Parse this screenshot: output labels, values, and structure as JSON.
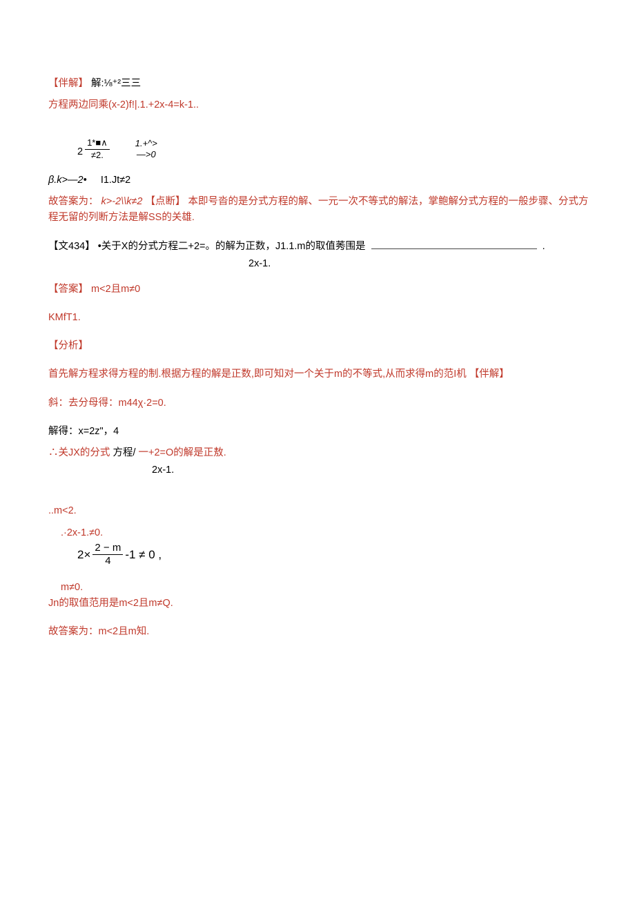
{
  "watermark": "",
  "l1": {
    "tag": "【伴解】",
    "body": "解:⅛⁺²三三"
  },
  "l2": "方程两边同乘(x-2)f!|.1.+2x-4=k-1..",
  "frac2": {
    "lhs_pre": "2",
    "num1": "1*■∧",
    "den1": "≠2.",
    "num2": "1.+^>",
    "den2": "—>0"
  },
  "l3": {
    "a": "β.k>—2•",
    "b": "I1.Jt≠2"
  },
  "l4": {
    "a": "故答案为：",
    "b": "k>-2\\\\k≠2",
    "c": "【点断】",
    "d": "本即号沓的是分式方程的解、一元一次不等式的解法，掌鲍解分式方程的一般步骤、分式方程无留的列断方法是解SS的关雄."
  },
  "q": {
    "label": "【文434】",
    "body": "•关于X的分式方程二+2=。的解为正数，J1.1.m的取值莠围是",
    "tail": ".",
    "sub": "2x-1."
  },
  "ans": {
    "tag": "【答案】",
    "body": "m<2且m≠0"
  },
  "km": "KMfT1.",
  "fx": "【分析】",
  "fxbody": {
    "a": "首先解方程求得方程的制.根据方程的解是正数,即可知对一个关于m的不等式,从而求得m的范I机",
    "b": "【伴解】"
  },
  "s1": "斜：去分母得：m44χ·2=0.",
  "s2": "解得：x=2z\"，4",
  "s3": {
    "a": "∴关JX的分式",
    "b": "方程/",
    "c": "一+2=O的解是正敖."
  },
  "s3sub": "2x-1.",
  "s4": "..m<2.",
  "s5": ".·2x-1.≠0.",
  "frac3": {
    "pre": "2×",
    "num": "2 − m",
    "den": "4",
    "post": "-1 ≠ 0 ,"
  },
  "s6": "m≠0.",
  "s7": "Jn的取值范用是m<2且m≠Q.",
  "s8": "故答案为：m<2且m知."
}
